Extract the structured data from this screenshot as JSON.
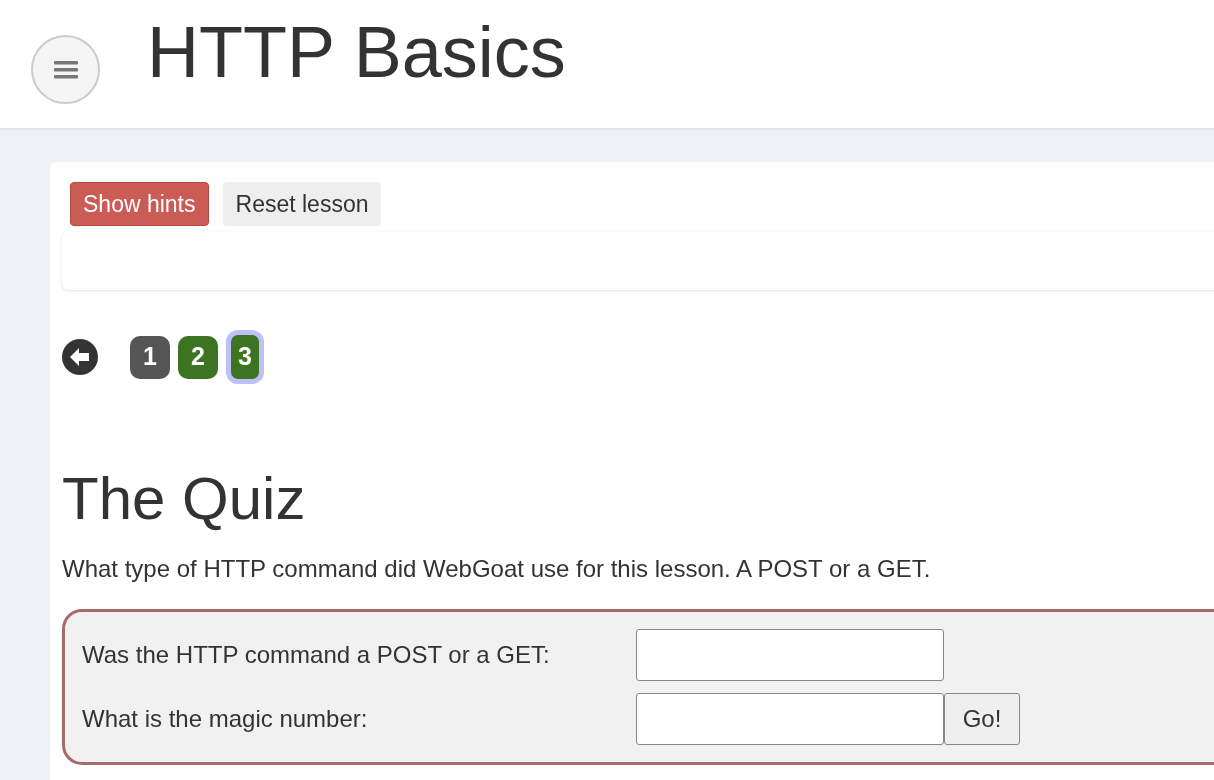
{
  "header": {
    "title": "HTTP Basics"
  },
  "lesson_controls": {
    "buttons": [
      {
        "label": "Show hints",
        "kind": "danger"
      },
      {
        "label": "Reset lesson",
        "kind": "default"
      }
    ]
  },
  "page_nav": {
    "pages": [
      {
        "label": "1",
        "selected": false,
        "completed": false
      },
      {
        "label": "2",
        "selected": false,
        "completed": true
      },
      {
        "label": "3",
        "selected": true,
        "completed": true
      }
    ]
  },
  "quiz": {
    "heading": "The Quiz",
    "description": "What type of HTTP command did WebGoat use for this lesson. A POST or a GET.",
    "fields": [
      {
        "label": "Was the HTTP command a POST or a GET:"
      },
      {
        "label": "What is the magic number:"
      }
    ],
    "submit_button": "Go!"
  }
}
